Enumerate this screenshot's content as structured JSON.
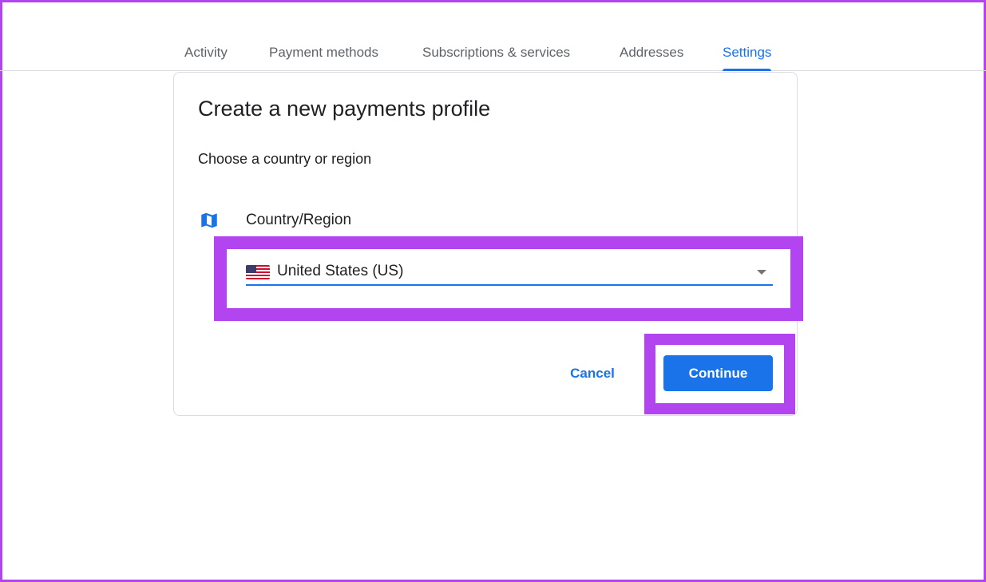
{
  "tabs": [
    {
      "label": "Activity",
      "active": false
    },
    {
      "label": "Payment methods",
      "active": false
    },
    {
      "label": "Subscriptions & services",
      "active": false
    },
    {
      "label": "Addresses",
      "active": false
    },
    {
      "label": "Settings",
      "active": true
    }
  ],
  "dialog": {
    "title": "Create a new payments profile",
    "subtitle": "Choose a country or region",
    "field_label": "Country/Region",
    "field_icon": "map-icon",
    "selected_country": "United States (US)",
    "selected_flag": "us-flag-icon",
    "cancel_label": "Cancel",
    "continue_label": "Continue"
  },
  "colors": {
    "accent": "#1a73e8",
    "highlight": "#b245f0",
    "text": "#202124",
    "muted": "#5f6368",
    "divider": "#dadce0"
  }
}
